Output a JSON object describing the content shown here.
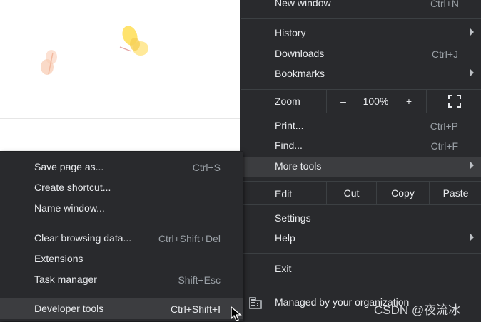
{
  "main_menu": {
    "new_window": {
      "label": "New window",
      "shortcut": "Ctrl+N"
    },
    "history": {
      "label": "History"
    },
    "downloads": {
      "label": "Downloads",
      "shortcut": "Ctrl+J"
    },
    "bookmarks": {
      "label": "Bookmarks"
    },
    "zoom": {
      "label": "Zoom",
      "minus": "–",
      "value": "100%",
      "plus": "+"
    },
    "print": {
      "label": "Print...",
      "shortcut": "Ctrl+P"
    },
    "find": {
      "label": "Find...",
      "shortcut": "Ctrl+F"
    },
    "more_tools": {
      "label": "More tools"
    },
    "edit": {
      "label": "Edit",
      "cut": "Cut",
      "copy": "Copy",
      "paste": "Paste"
    },
    "settings": {
      "label": "Settings"
    },
    "help": {
      "label": "Help"
    },
    "exit": {
      "label": "Exit"
    },
    "managed": {
      "label": "Managed by your organization"
    }
  },
  "more_tools_menu": {
    "items": [
      {
        "label": "Save page as...",
        "shortcut": "Ctrl+S"
      },
      {
        "label": "Create shortcut...",
        "shortcut": ""
      },
      {
        "label": "Name window...",
        "shortcut": ""
      },
      {
        "label": "Clear browsing data...",
        "shortcut": "Ctrl+Shift+Del"
      },
      {
        "label": "Extensions",
        "shortcut": ""
      },
      {
        "label": "Task manager",
        "shortcut": "Shift+Esc"
      },
      {
        "label": "Developer tools",
        "shortcut": "Ctrl+Shift+I"
      }
    ]
  },
  "watermark": "CSDN @夜流冰",
  "colors": {
    "menu_bg": "#292a2d",
    "highlight": "#3c3d40",
    "text": "#e8eaed",
    "shortcut": "#9aa0a6",
    "separator": "#3c4043"
  }
}
